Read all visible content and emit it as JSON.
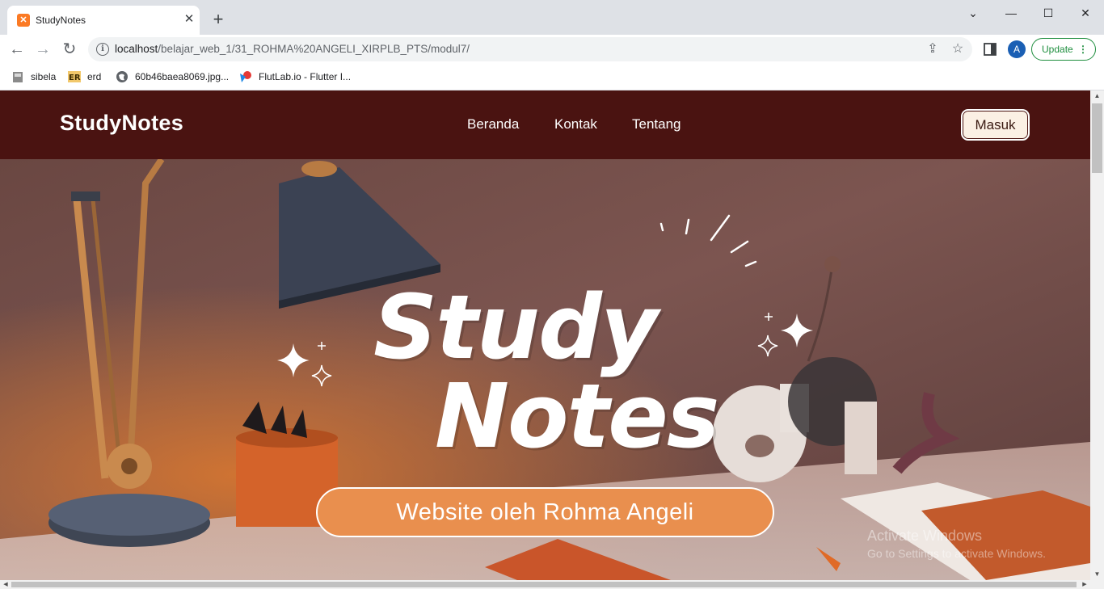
{
  "browser": {
    "tab_title": "StudyNotes",
    "tab_favicon": "xampp-icon",
    "url_host": "localhost",
    "url_path": "/belajar_web_1/31_ROHMA%20ANGELI_XIRPLB_PTS/modul7/",
    "avatar_letter": "A",
    "update_label": "Update",
    "bookmarks": [
      {
        "label": "sibela",
        "icon": "app-icon"
      },
      {
        "label": "erd",
        "icon": "er-icon"
      },
      {
        "label": "60b46baea8069.jpg...",
        "icon": "globe-icon"
      },
      {
        "label": "FlutLab.io - Flutter I...",
        "icon": "flutlab-icon"
      }
    ]
  },
  "site": {
    "brand": "StudyNotes",
    "nav": [
      "Beranda",
      "Kontak",
      "Tentang"
    ],
    "login_label": "Masuk",
    "hero": {
      "title_line1": "Study",
      "title_line2": "Notes",
      "subtitle": "Website oleh Rohma Angeli"
    }
  },
  "os": {
    "watermark_title": "Activate Windows",
    "watermark_sub": "Go to Settings to activate Windows."
  },
  "colors": {
    "navbar_bg": "#4a1311",
    "login_bg": "#fbf0e4",
    "pill_bg": "#e98f4e",
    "update_green": "#1e8e3e"
  }
}
